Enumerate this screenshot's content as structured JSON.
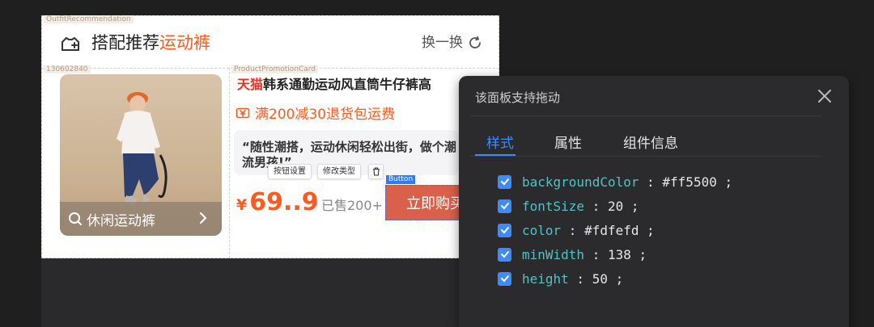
{
  "labels": {
    "outfit_tag": "OutfitRecommendation",
    "id_tag": "130602840",
    "promo_card_tag": "ProductPromotionCard",
    "button_tag": "Button"
  },
  "header": {
    "title_prefix": "搭配推荐",
    "title_highlight": "运动裤",
    "swap_label": "换一换"
  },
  "image_card": {
    "search_label": "休闲运动裤"
  },
  "product": {
    "brand": "天猫",
    "title": "韩系通勤运动风直筒牛仔裤高",
    "promo": "满200减30退货包运费",
    "quote": "“随性潮搭，运动休闲轻松出街，做个潮流男孩!”",
    "currency": "¥",
    "price": "69..9",
    "sold": "已售200+",
    "buy_label": "立即购买"
  },
  "floating_toolbar": {
    "settings": "按钮设置",
    "change_type": "修改类型"
  },
  "panel": {
    "title": "该面板支持拖动",
    "tabs": [
      {
        "label": "样式",
        "active": true
      },
      {
        "label": "属性",
        "active": false
      },
      {
        "label": "组件信息",
        "active": false
      }
    ],
    "properties": [
      {
        "key": "backgroundColor",
        "value": "#ff5500",
        "checked": true
      },
      {
        "key": "fontSize",
        "value": "20",
        "checked": true
      },
      {
        "key": "color",
        "value": "#fdfefd",
        "checked": true
      },
      {
        "key": "minWidth",
        "value": "138",
        "checked": true
      },
      {
        "key": "height",
        "value": "50",
        "checked": true
      }
    ]
  },
  "colors": {
    "accent": "#ff5a1f",
    "brand_red": "#ff2a1a",
    "selection_blue": "#2f7cf6",
    "tab_active": "#3d8bff"
  }
}
